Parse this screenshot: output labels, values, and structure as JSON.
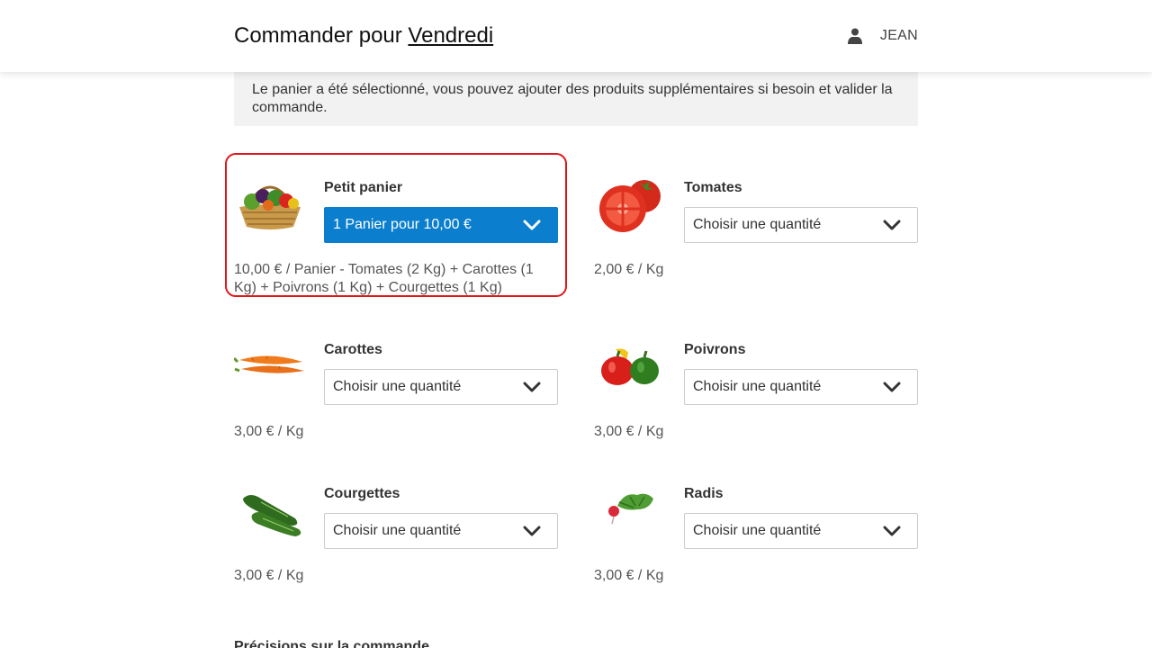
{
  "header": {
    "title_prefix": "Commander pour",
    "day_link": "Vendredi",
    "user_name": "JEAN",
    "user_icon": "user-icon"
  },
  "info_message": "Le panier a été sélectionné, vous pouvez ajouter des produits supplémentaires si besoin et valider la commande.",
  "colors": {
    "accent": "#0b7fcd",
    "selected_outline": "#e0161b",
    "info_bg": "#f2f2f2"
  },
  "products": [
    {
      "name": "Petit panier",
      "select_value": "1 Panier pour 10,00 €",
      "price": "10,00 € / Panier - Tomates (2 Kg) + Carottes (1 Kg) + Poivrons (1 Kg) + Courgettes (1 Kg)",
      "image": "basket-image",
      "selected": true
    },
    {
      "name": "Tomates",
      "select_value": "Choisir une quantité",
      "price": "2,00 € / Kg",
      "image": "tomatoes-image",
      "selected": false
    },
    {
      "name": "Carottes",
      "select_value": "Choisir une quantité",
      "price": "3,00 € / Kg",
      "image": "carrots-image",
      "selected": false
    },
    {
      "name": "Poivrons",
      "select_value": "Choisir une quantité",
      "price": "3,00 € / Kg",
      "image": "peppers-image",
      "selected": false
    },
    {
      "name": "Courgettes",
      "select_value": "Choisir une quantité",
      "price": "3,00 € / Kg",
      "image": "zucchini-image",
      "selected": false
    },
    {
      "name": "Radis",
      "select_value": "Choisir une quantité",
      "price": "3,00 € / Kg",
      "image": "radish-image",
      "selected": false
    }
  ],
  "order_details_title": "Précisions sur la commande"
}
